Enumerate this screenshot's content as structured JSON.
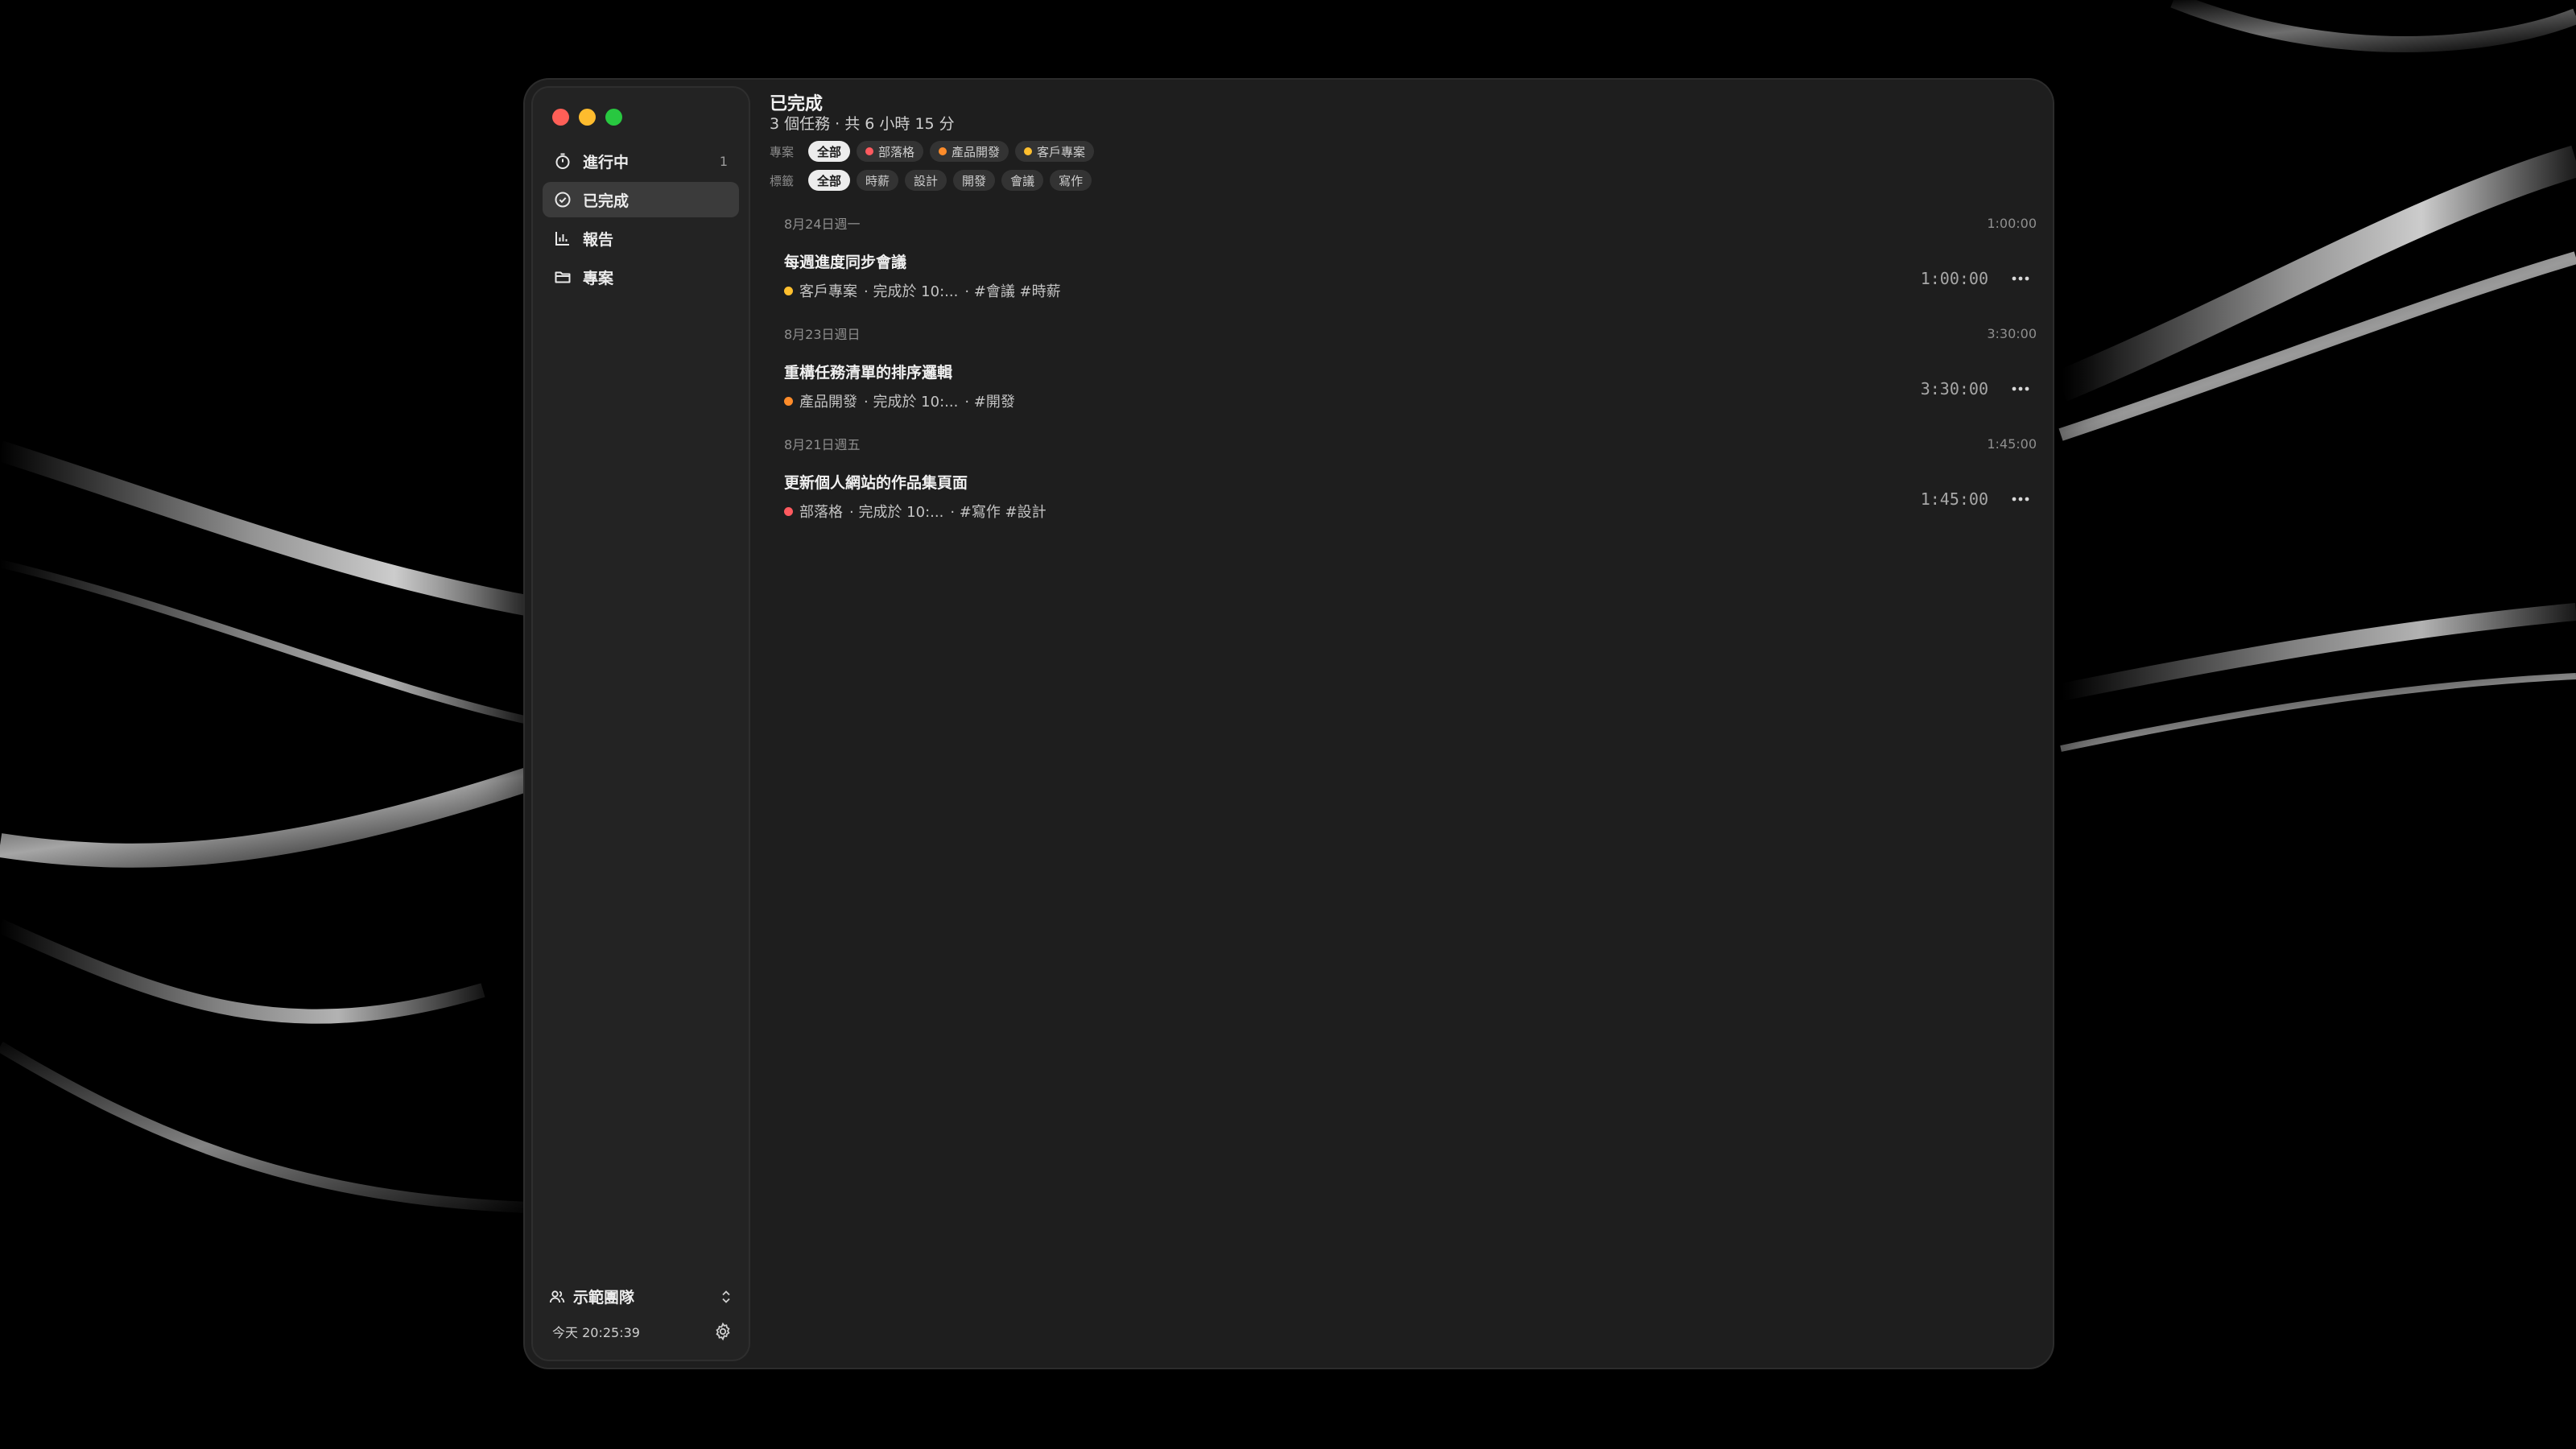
{
  "colors": {
    "blog": "#ff5a5f",
    "product": "#ff8c2a",
    "client": "#ffbf2e"
  },
  "sidebar": {
    "items": [
      {
        "label": "進行中",
        "count": "1",
        "icon": "timer-icon"
      },
      {
        "label": "已完成",
        "count": "",
        "icon": "check-circle-icon"
      },
      {
        "label": "報告",
        "count": "",
        "icon": "bar-chart-icon"
      },
      {
        "label": "專案",
        "count": "",
        "icon": "folder-icon"
      }
    ],
    "team": "示範團隊",
    "clock": "今天 20:25:39"
  },
  "header": {
    "title": "已完成",
    "subtitle": "3 個任務 · 共 6 小時 15 分"
  },
  "filters": {
    "project_label": "專案",
    "projects": [
      "全部",
      "部落格",
      "產品開發",
      "客戶專案"
    ],
    "tag_label": "標籤",
    "tags": [
      "全部",
      "時薪",
      "設計",
      "開發",
      "會議",
      "寫作"
    ]
  },
  "groups": [
    {
      "date": "8月24日週一",
      "total": "1:00:00",
      "task": {
        "title": "每週進度同步會議",
        "project": "客戶專案",
        "completed": "· 完成於 10:...",
        "tags": "· #會議 #時薪",
        "duration": "1:00:00"
      }
    },
    {
      "date": "8月23日週日",
      "total": "3:30:00",
      "task": {
        "title": "重構任務清單的排序邏輯",
        "project": "產品開發",
        "completed": "· 完成於 10:...",
        "tags": "· #開發",
        "duration": "3:30:00"
      }
    },
    {
      "date": "8月21日週五",
      "total": "1:45:00",
      "task": {
        "title": "更新個人網站的作品集頁面",
        "project": "部落格",
        "completed": "· 完成於 10:...",
        "tags": "· #寫作 #設計",
        "duration": "1:45:00"
      }
    }
  ]
}
